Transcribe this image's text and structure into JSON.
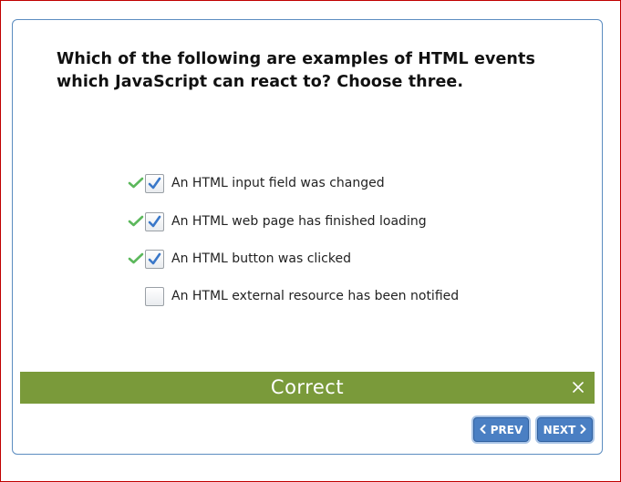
{
  "question": {
    "text": "Which of the following are examples of HTML events which JavaScript can react to? Choose three."
  },
  "options": [
    {
      "label": "An HTML input field was changed",
      "checked": true,
      "correct_mark": true
    },
    {
      "label": "An HTML web page has finished loading",
      "checked": true,
      "correct_mark": true
    },
    {
      "label": "An HTML button was clicked",
      "checked": true,
      "correct_mark": true
    },
    {
      "label": "An HTML external resource has been notified",
      "checked": false,
      "correct_mark": false
    }
  ],
  "feedback": {
    "text": "Correct",
    "color": "#7a9a3a",
    "close_icon": "close-icon"
  },
  "nav": {
    "prev_label": "PREV",
    "next_label": "NEXT",
    "prev_icon": "chevron-left-icon",
    "next_icon": "chevron-right-icon",
    "button_color": "#4a7fc3"
  },
  "colors": {
    "frame_border": "#c00000",
    "card_border": "#5b8cc0",
    "check_green": "#5cb85c",
    "check_blue": "#3a78c9"
  }
}
